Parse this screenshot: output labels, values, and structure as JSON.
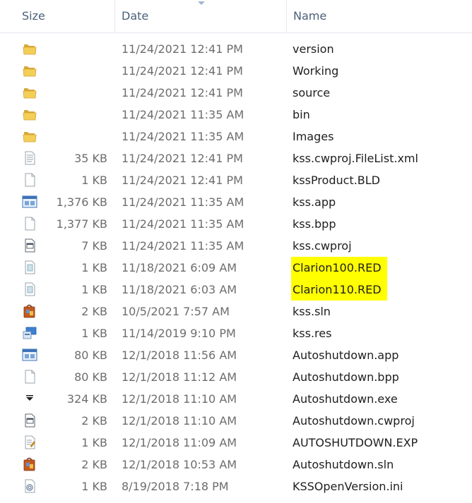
{
  "columns": {
    "size": "Size",
    "date": "Date",
    "name": "Name"
  },
  "files": [
    {
      "size": "",
      "date": "11/24/2021 12:41 PM",
      "name": "version",
      "icon": "folder-icon"
    },
    {
      "size": "",
      "date": "11/24/2021 12:41 PM",
      "name": "Working",
      "icon": "folder-icon"
    },
    {
      "size": "",
      "date": "11/24/2021 12:41 PM",
      "name": "source",
      "icon": "folder-icon"
    },
    {
      "size": "",
      "date": "11/24/2021 11:35 AM",
      "name": "bin",
      "icon": "folder-icon"
    },
    {
      "size": "",
      "date": "11/24/2021 11:35 AM",
      "name": "Images",
      "icon": "folder-icon"
    },
    {
      "size": "35 KB",
      "date": "11/24/2021 12:41 PM",
      "name": "kss.cwproj.FileList.xml",
      "icon": "text-document-icon"
    },
    {
      "size": "1 KB",
      "date": "11/24/2021 12:41 PM",
      "name": "kssProduct.BLD",
      "icon": "blank-file-icon"
    },
    {
      "size": "1,376 KB",
      "date": "11/24/2021 11:35 AM",
      "name": "kss.app",
      "icon": "app-window-icon"
    },
    {
      "size": "1,377 KB",
      "date": "11/24/2021 11:35 AM",
      "name": "kss.bpp",
      "icon": "blank-file-icon"
    },
    {
      "size": "7 KB",
      "date": "11/24/2021 11:35 AM",
      "name": "kss.cwproj",
      "icon": "project-file-icon"
    },
    {
      "size": "1 KB",
      "date": "11/18/2021 6:09 AM",
      "name": "Clarion100.RED",
      "icon": "red-file-icon",
      "highlight": true
    },
    {
      "size": "1 KB",
      "date": "11/18/2021 6:03 AM",
      "name": "Clarion110.RED",
      "icon": "red-file-icon",
      "highlight": true
    },
    {
      "size": "2 KB",
      "date": "10/5/2021 7:57 AM",
      "name": "kss.sln",
      "icon": "solution-file-icon"
    },
    {
      "size": "1 KB",
      "date": "11/14/2019 9:10 PM",
      "name": "kss.res",
      "icon": "resource-file-icon"
    },
    {
      "size": "80 KB",
      "date": "12/1/2018 11:56 AM",
      "name": "Autoshutdown.app",
      "icon": "app-window-icon"
    },
    {
      "size": "80 KB",
      "date": "12/1/2018 11:12 AM",
      "name": "Autoshutdown.bpp",
      "icon": "blank-file-icon"
    },
    {
      "size": "324 KB",
      "date": "12/1/2018 11:10 AM",
      "name": "Autoshutdown.exe",
      "icon": "executable-icon"
    },
    {
      "size": "2 KB",
      "date": "12/1/2018 11:10 AM",
      "name": "Autoshutdown.cwproj",
      "icon": "project-file-icon"
    },
    {
      "size": "1 KB",
      "date": "12/1/2018 11:09 AM",
      "name": "AUTOSHUTDOWN.EXP",
      "icon": "exp-file-icon"
    },
    {
      "size": "2 KB",
      "date": "12/1/2018 10:53 AM",
      "name": "Autoshutdown.sln",
      "icon": "solution-file-icon"
    },
    {
      "size": "1 KB",
      "date": "8/19/2018 7:18 PM",
      "name": "KSSOpenVersion.ini",
      "icon": "settings-file-icon"
    }
  ],
  "colors": {
    "highlight": "#ffff00",
    "header_text": "#4c607a",
    "detail_text": "#6d6d6d",
    "name_text": "#1e1e1e",
    "folder": "#f4cf57"
  }
}
